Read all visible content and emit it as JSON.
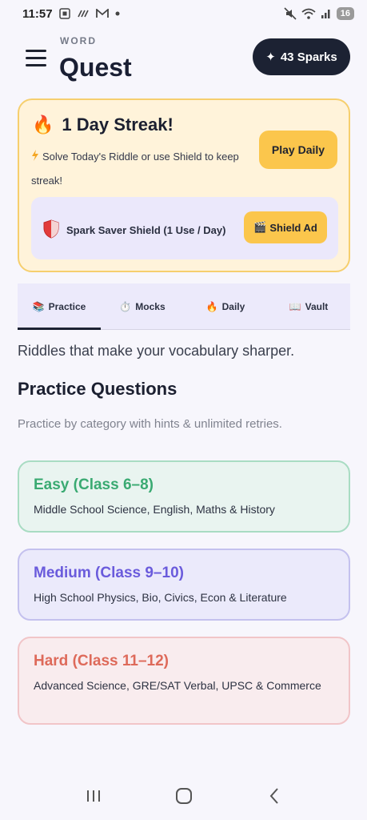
{
  "status_bar": {
    "time": "11:57",
    "battery": "16",
    "icons_left": [
      "screenshot-icon",
      "wifi-calling-icon",
      "gmail-icon",
      "dot-icon"
    ],
    "icons_right": [
      "mute-icon",
      "wifi-icon",
      "signal-icon"
    ]
  },
  "header": {
    "brand_small": "WORD",
    "brand_big": "Quest",
    "sparks_icon": "✦",
    "sparks_label": "43 Sparks"
  },
  "streak": {
    "icon": "🔥",
    "title": "1 Day Streak!",
    "description": "Solve Today's Riddle or use Shield to keep streak!",
    "play_label": "Play Daily",
    "shield_label": "Spark Saver Shield (1 Use / Day)",
    "shield_ad_label": "Shield Ad",
    "shield_ad_icon": "🎬"
  },
  "tabs": [
    {
      "icon": "📚",
      "label": "Practice",
      "active": true
    },
    {
      "icon": "⏱️",
      "label": "Mocks",
      "active": false
    },
    {
      "icon": "🔥",
      "label": "Daily",
      "active": false
    },
    {
      "icon": "📖",
      "label": "Vault",
      "active": false
    }
  ],
  "content": {
    "tagline": "Riddles that make your vocabulary sharper.",
    "section_title": "Practice Questions",
    "section_sub": "Practice by category with hints & unlimited retries."
  },
  "categories": [
    {
      "title": "Easy (Class 6–8)",
      "desc": "Middle School Science, English, Maths & History"
    },
    {
      "title": "Medium (Class 9–10)",
      "desc": "High School Physics, Bio, Civics, Econ & Literature"
    },
    {
      "title": "Hard (Class 11–12)",
      "desc": "Advanced Science, GRE/SAT Verbal, UPSC & Commerce"
    }
  ],
  "colors": {
    "accent_dark": "#1c2233",
    "accent_yellow": "#fbc64c",
    "easy": "#3aaa72",
    "medium": "#6a5bdc",
    "hard": "#de6a5a"
  }
}
